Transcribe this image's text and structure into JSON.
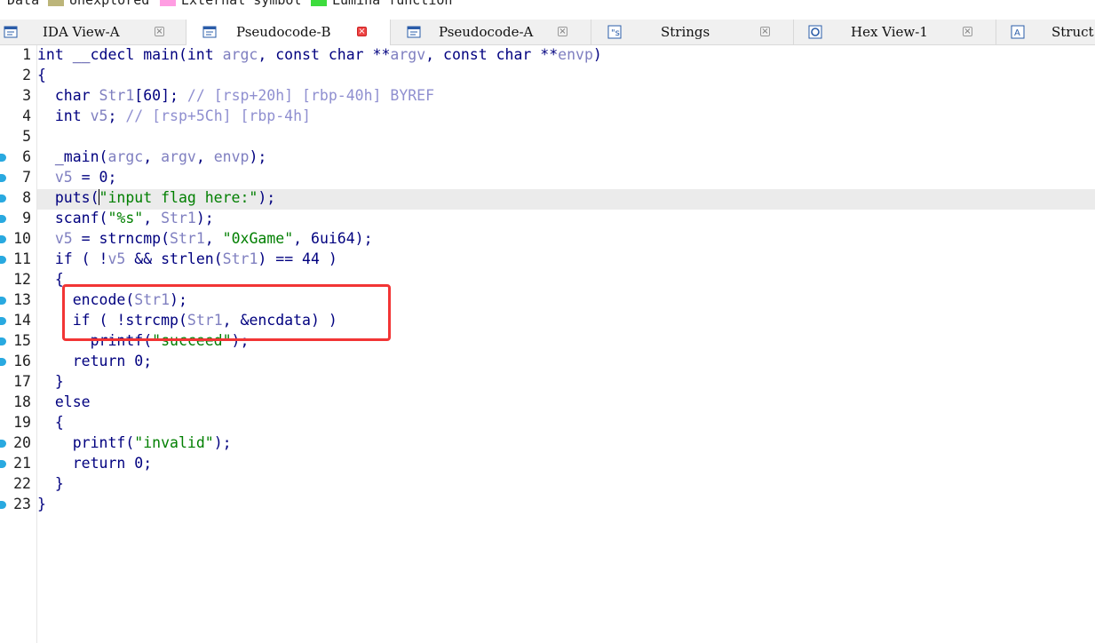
{
  "legend": [
    {
      "label": "Data",
      "color": ""
    },
    {
      "label": "Unexplored",
      "color": "#bcb57a"
    },
    {
      "label": "External symbol",
      "color": "#ff9de2"
    },
    {
      "label": "Lumina function",
      "color": "#3ddc3d"
    }
  ],
  "tabs": [
    {
      "label": "IDA View-A",
      "icon": "ida-view-icon",
      "active": false
    },
    {
      "label": "Pseudocode-B",
      "icon": "pseudocode-icon",
      "active": true
    },
    {
      "label": "Pseudocode-A",
      "icon": "pseudocode-icon",
      "active": false
    },
    {
      "label": "Strings",
      "icon": "strings-icon",
      "active": false
    },
    {
      "label": "Hex View-1",
      "icon": "hex-view-icon",
      "active": false
    },
    {
      "label": "Struct",
      "icon": "structures-icon",
      "active": false
    }
  ],
  "close_glyph": "×",
  "code_lines": [
    {
      "n": "1",
      "text": "int __cdecl main(int argc, const char **argv, const char **envp)"
    },
    {
      "n": "2",
      "text": "{"
    },
    {
      "n": "3",
      "text": "  char Str1[60]; // [rsp+20h] [rbp-40h] BYREF"
    },
    {
      "n": "4",
      "text": "  int v5; // [rsp+5Ch] [rbp-4h]"
    },
    {
      "n": "5",
      "text": ""
    },
    {
      "n": "6",
      "text": "  _main(argc, argv, envp);"
    },
    {
      "n": "7",
      "text": "  v5 = 0;"
    },
    {
      "n": "8",
      "text": "  puts(\"input flag here:\");"
    },
    {
      "n": "9",
      "text": "  scanf(\"%s\", Str1);"
    },
    {
      "n": "10",
      "text": "  v5 = strncmp(Str1, \"0xGame\", 6ui64);"
    },
    {
      "n": "11",
      "text": "  if ( !v5 && strlen(Str1) == 44 )"
    },
    {
      "n": "12",
      "text": "  {"
    },
    {
      "n": "13",
      "text": "    encode(Str1);"
    },
    {
      "n": "14",
      "text": "    if ( !strcmp(Str1, &encdata) )"
    },
    {
      "n": "15",
      "text": "      printf(\"succeed\");"
    },
    {
      "n": "16",
      "text": "    return 0;"
    },
    {
      "n": "17",
      "text": "  }"
    },
    {
      "n": "18",
      "text": "  else"
    },
    {
      "n": "19",
      "text": "  {"
    },
    {
      "n": "20",
      "text": "    printf(\"invalid\");"
    },
    {
      "n": "21",
      "text": "    return 0;"
    },
    {
      "n": "22",
      "text": "  }"
    },
    {
      "n": "23",
      "text": "}"
    }
  ],
  "colors": {
    "keyword": "#00007f",
    "variable": "#7f7fc0",
    "string": "#007f00",
    "comment": "#8f8fd0",
    "annotation_box": "#f23535",
    "breakpoint_marker": "#29a9e0"
  }
}
